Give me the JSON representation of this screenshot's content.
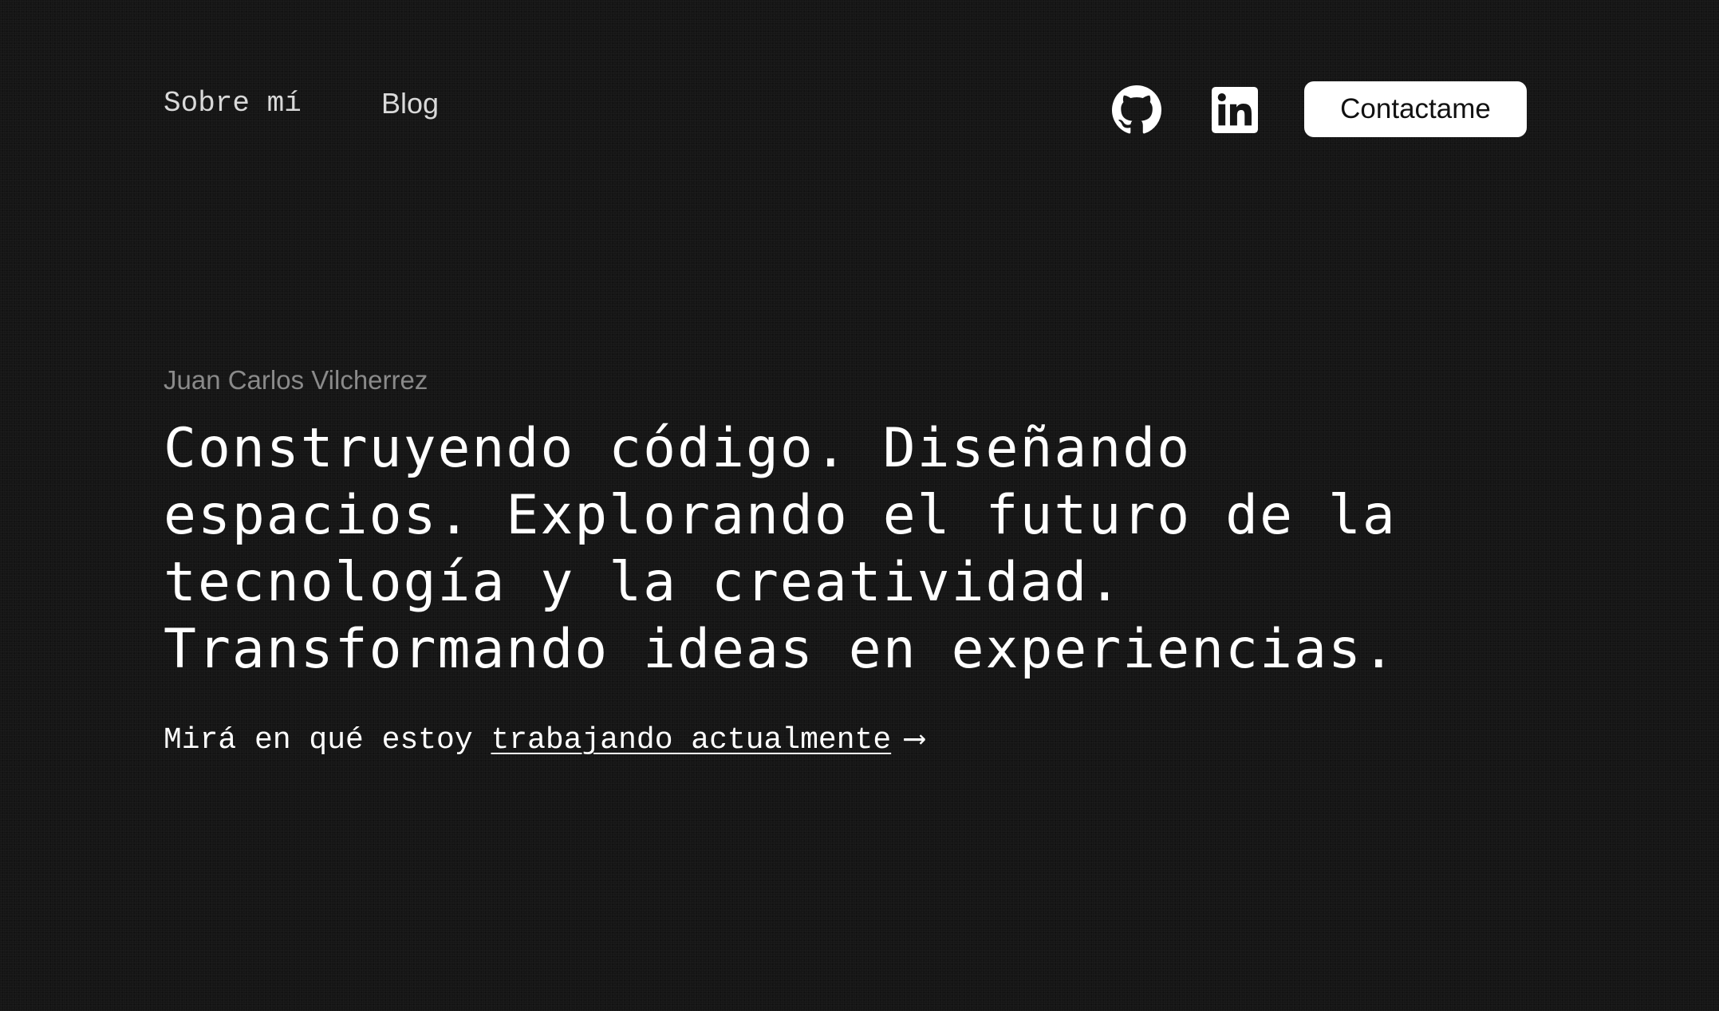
{
  "nav": {
    "about_label": "Sobre mí",
    "blog_label": "Blog",
    "github_icon": "github-icon",
    "linkedin_icon": "linkedin-icon",
    "contact_label": "Contactame"
  },
  "hero": {
    "author": "Juan Carlos Vilcherrez",
    "headline": "Construyendo código. Diseñando espacios. Explorando el futuro de la tecnología y la creatividad. Transformando ideas en experiencias.",
    "cta_prefix": "Mirá en qué estoy ",
    "cta_link": "trabajando actualmente",
    "cta_arrow": "⟶"
  },
  "colors": {
    "background": "#151515",
    "text": "#ffffff",
    "muted": "#8a8a8a",
    "button_bg": "#ffffff",
    "button_text": "#111111"
  }
}
